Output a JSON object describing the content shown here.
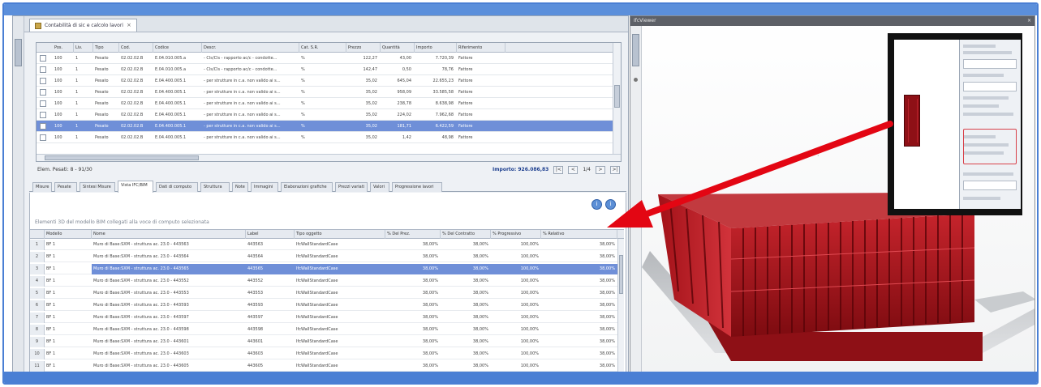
{
  "document_tab": {
    "label": "Contabilità di sic e calcolo lavori",
    "close": "×"
  },
  "upper_grid": {
    "columns": [
      "Pos.",
      "Liv.",
      "Tipo",
      "Cod.",
      "Codice",
      "Descr.",
      "Cat. S.R.",
      "Prezzo",
      "Quantità",
      "Importo",
      "Riferimento"
    ],
    "rows": [
      [
        "100",
        "1",
        "Pesato",
        "02.02.02.B",
        "E.04.010.005.a",
        "- Cls/Cls - rapporto ac/c - condotte...",
        "%",
        "122,27",
        "43,00",
        "7.720,39",
        "Fattore"
      ],
      [
        "100",
        "1",
        "Pesato",
        "02.02.02.B",
        "E.04.010.005.a",
        "- Cls/Cls - rapporto ac/c - condotte...",
        "%",
        "142,47",
        "0,50",
        "78,76",
        "Fattore"
      ],
      [
        "100",
        "1",
        "Pesato",
        "02.02.02.B",
        "E.04.400.005.1",
        "- per strutture in c.a. non valido ai s...",
        "%",
        "35,02",
        "645,04",
        "22.655,23",
        "Fattore"
      ],
      [
        "100",
        "1",
        "Pesato",
        "02.02.02.B",
        "E.04.400.005.1",
        "- per strutture in c.a. non valido ai s...",
        "%",
        "35,02",
        "958,09",
        "33.585,58",
        "Fattore"
      ],
      [
        "100",
        "1",
        "Pesato",
        "02.02.02.B",
        "E.04.400.005.1",
        "- per strutture in c.a. non valido ai s...",
        "%",
        "35,02",
        "238,78",
        "8.638,98",
        "Fattore"
      ],
      [
        "100",
        "1",
        "Pesato",
        "02.02.02.B",
        "E.04.400.005.1",
        "- per strutture in c.a. non valido ai s...",
        "%",
        "35,02",
        "224,02",
        "7.962,68",
        "Fattore"
      ],
      [
        "100",
        "1",
        "Pesato",
        "02.02.02.B",
        "E.04.400.005.1",
        "- per strutture in c.a. non valido ai s...",
        "%",
        "35,02",
        "181,71",
        "6.422,59",
        "Fattore"
      ],
      [
        "100",
        "1",
        "Pesato",
        "02.02.02.B",
        "E.04.400.005.1",
        "- per strutture in c.a. non valido ai s...",
        "%",
        "35,02",
        "1,42",
        "48,98",
        "Fattore"
      ]
    ],
    "selected_row": 6
  },
  "status": {
    "left": "Elem. Pesati: 8 - 91/30",
    "amount_label": "Importo: 926.086,83",
    "pages": "1/4",
    "nav": [
      "|<",
      "<",
      ">",
      ">|"
    ]
  },
  "tabs": [
    "Misure",
    "Pesate",
    "Sintesi Misure",
    "Vista IFC/BIM",
    "Dati di computo",
    "Struttura",
    "Note",
    "Immagini",
    "Elaborazioni grafiche",
    "Prezzi variati",
    "Valori",
    "Progressione lavori"
  ],
  "active_tab": 3,
  "info_buttons": [
    "i",
    "i"
  ],
  "lower_caption": "Elementi 3D del modello BIM collegati alla voce di computo selezionata",
  "lower_grid": {
    "columns": [
      "",
      "Modello",
      "Nome",
      "Label",
      "Tipo oggetto",
      "% Del Prez.",
      "% Del Contratto",
      "% Progressivo",
      "% Relativo"
    ],
    "rows": [
      [
        "1",
        "BF 1",
        "Muro di Base:SXM - struttura ac. 23.0 - 443563",
        "443563",
        "IfcWallStandardCase",
        "38,00%",
        "38,00%",
        "100,00%",
        "38,00%"
      ],
      [
        "2",
        "BF 1",
        "Muro di Base:SXM - struttura ac. 23.0 - 443564",
        "443564",
        "IfcWallStandardCase",
        "38,00%",
        "38,00%",
        "100,00%",
        "38,00%"
      ],
      [
        "3",
        "BF 1",
        "Muro di Base:SXM - struttura ac. 23.0 - 443565",
        "443565",
        "IfcWallStandardCase",
        "38,00%",
        "38,00%",
        "100,00%",
        "38,00%"
      ],
      [
        "4",
        "BF 1",
        "Muro di Base:SXM - struttura ac. 23.0 - 443552",
        "443552",
        "IfcWallStandardCase",
        "38,00%",
        "38,00%",
        "100,00%",
        "38,00%"
      ],
      [
        "5",
        "BF 1",
        "Muro di Base:SXM - struttura ac. 23.0 - 443553",
        "443553",
        "IfcWallStandardCase",
        "38,00%",
        "38,00%",
        "100,00%",
        "38,00%"
      ],
      [
        "6",
        "BF 1",
        "Muro di Base:SXM - struttura ac. 23.0 - 443593",
        "443593",
        "IfcWallStandardCase",
        "38,00%",
        "38,00%",
        "100,00%",
        "38,00%"
      ],
      [
        "7",
        "BF 1",
        "Muro di Base:SXM - struttura ac. 23.0 - 443597",
        "443597",
        "IfcWallStandardCase",
        "38,00%",
        "38,00%",
        "100,00%",
        "38,00%"
      ],
      [
        "8",
        "BF 1",
        "Muro di Base:SXM - struttura ac. 23.0 - 443598",
        "443598",
        "IfcWallStandardCase",
        "38,00%",
        "38,00%",
        "100,00%",
        "38,00%"
      ],
      [
        "9",
        "BF 1",
        "Muro di Base:SXM - struttura ac. 23.0 - 443601",
        "443601",
        "IfcWallStandardCase",
        "38,00%",
        "38,00%",
        "100,00%",
        "38,00%"
      ],
      [
        "10",
        "BF 1",
        "Muro di Base:SXM - struttura ac. 23.0 - 443603",
        "443603",
        "IfcWallStandardCase",
        "38,00%",
        "38,00%",
        "100,00%",
        "38,00%"
      ],
      [
        "11",
        "BF 1",
        "Muro di Base:SXM - struttura ac. 23.0 - 443605",
        "443605",
        "IfcWallStandardCase",
        "38,00%",
        "38,00%",
        "100,00%",
        "38,00%"
      ]
    ],
    "selected_row": 2
  },
  "viewer": {
    "title": "IfcViewer",
    "close": "×"
  },
  "colors": {
    "accent": "#4a7fd4",
    "selection": "#6f8fd8",
    "model_red": "#b0141c",
    "arrow": "#e30613"
  }
}
